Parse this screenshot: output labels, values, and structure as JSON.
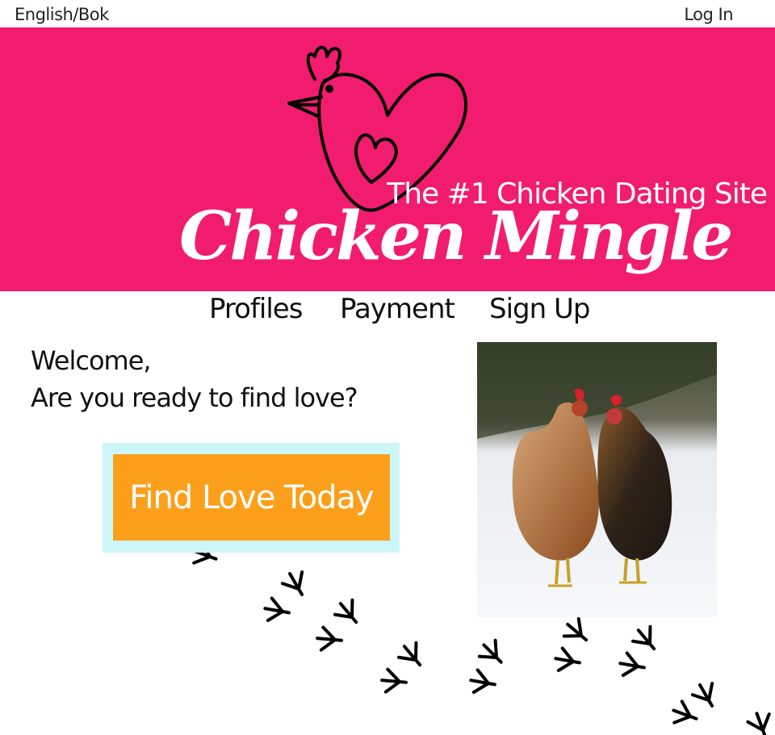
{
  "topbar": {
    "language_link": "English/Bok",
    "login_link": "Log In"
  },
  "header": {
    "tagline": "The #1 Chicken Dating Site",
    "brand_name": "Chicken Mingle",
    "logo_icon": "chicken-heart-icon"
  },
  "nav": {
    "items": [
      {
        "label": "Profiles"
      },
      {
        "label": "Payment"
      },
      {
        "label": "Sign Up"
      }
    ]
  },
  "main": {
    "welcome_line1": "Welcome,",
    "welcome_line2": "Are you ready to find love?",
    "cta_label": "Find Love Today",
    "photo": "two-chickens-in-snow-photo",
    "decoration": "chicken-footprints-icon"
  },
  "colors": {
    "brand": "#f21c6e",
    "cta": "#fc9f1b",
    "cta_frame": "#cdf6f8",
    "text": "#111111"
  }
}
